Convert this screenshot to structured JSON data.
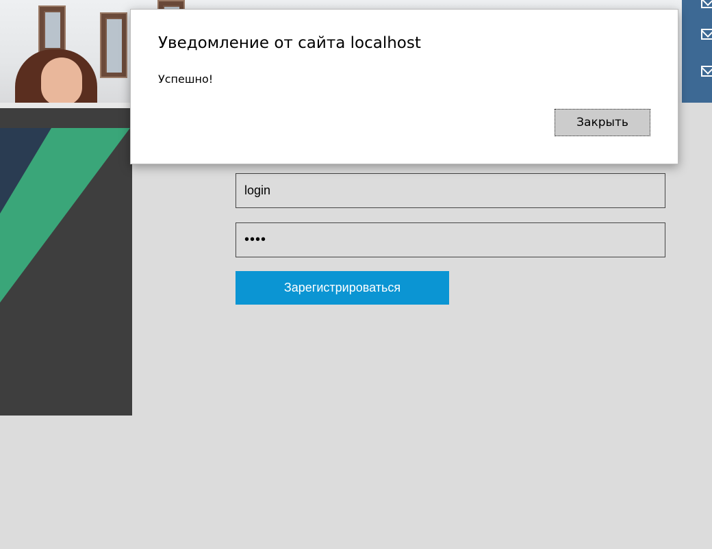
{
  "dialog": {
    "title": "Уведомление от сайта localhost",
    "message": "Успешно!",
    "close_label": "Закрыть"
  },
  "form": {
    "login_value": "login",
    "password_mask": "••••",
    "register_label": "Зарегистрироваться"
  },
  "header": {
    "icons": [
      "mail-icon",
      "mail-icon",
      "mail-icon"
    ]
  },
  "colors": {
    "page_bg": "#dcdcdc",
    "side_panel": "#3e3e3e",
    "side_stripe_green": "#3aa679",
    "side_stripe_navy": "#2a3c52",
    "header_blue": "#3d6994",
    "register_button": "#0b95d3",
    "dialog_button": "#cccccc"
  }
}
